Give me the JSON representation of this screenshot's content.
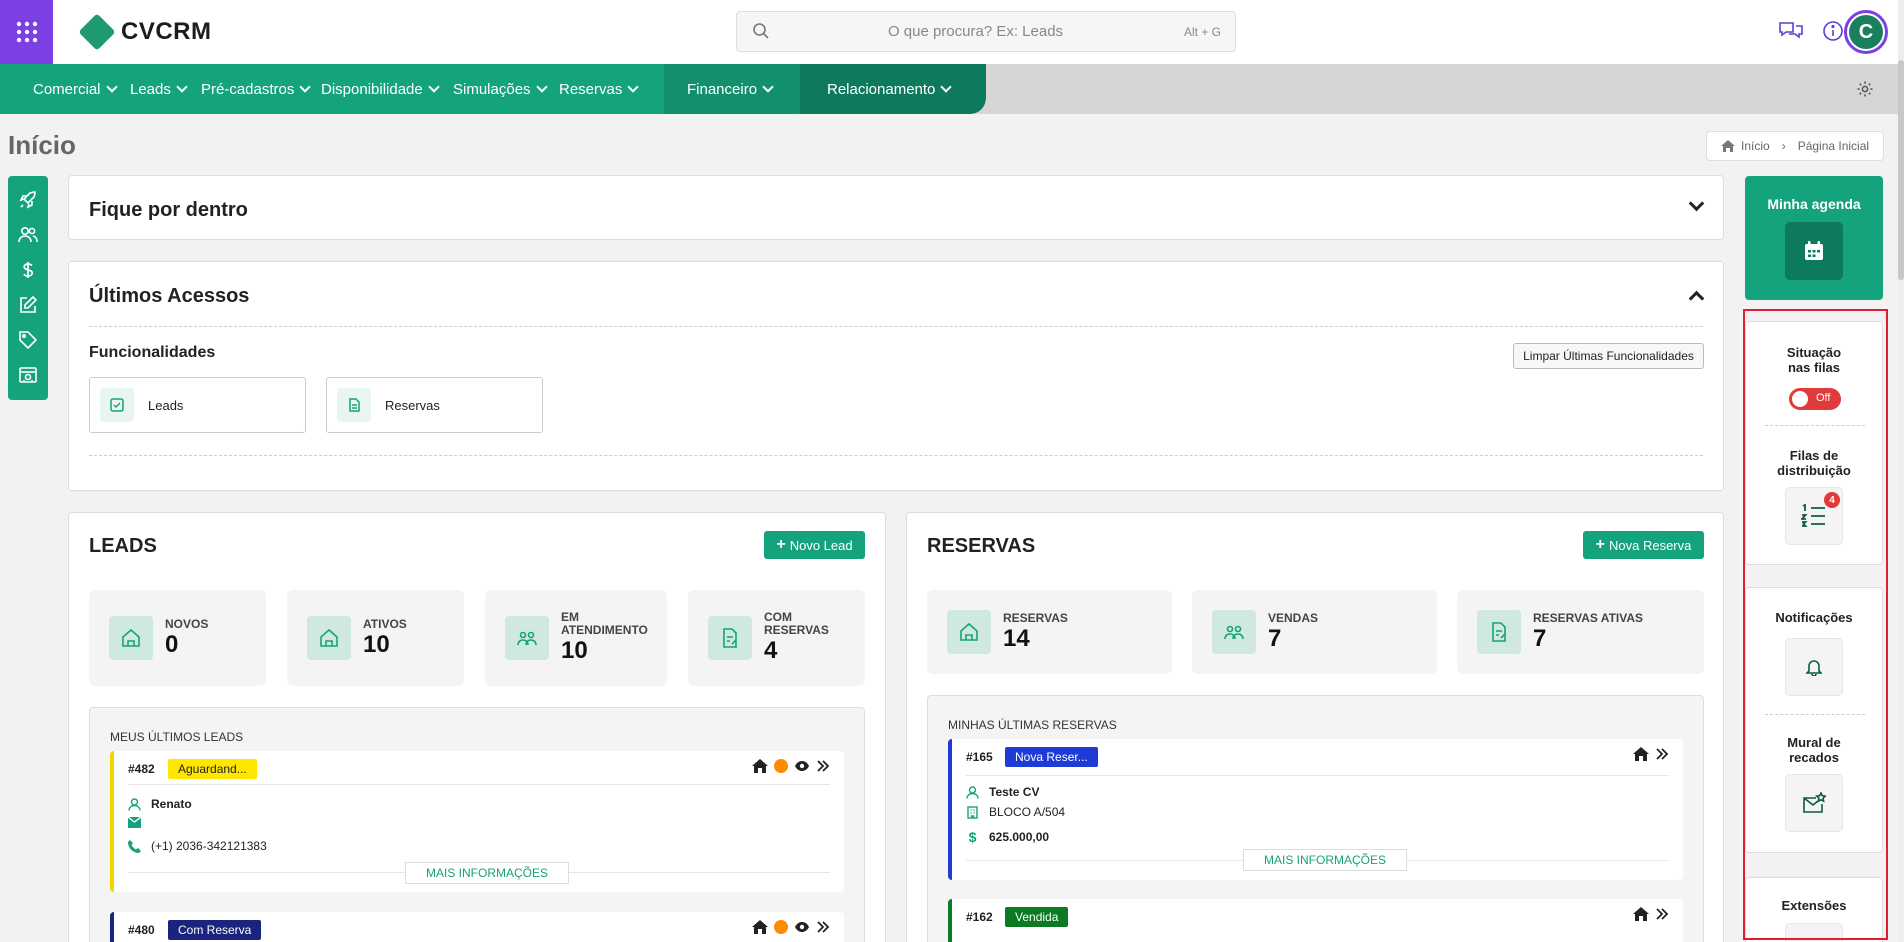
{
  "app": {
    "name": "CVCRM"
  },
  "search": {
    "placeholder": "O que procura? Ex: Leads",
    "shortcut": "Alt + G"
  },
  "user": {
    "initial": "C"
  },
  "nav": {
    "items": [
      "Comercial",
      "Leads",
      "Pré-cadastros",
      "Disponibilidade",
      "Simulações",
      "Reservas",
      "Financeiro",
      "Relacionamento"
    ]
  },
  "page": {
    "title": "Início"
  },
  "breadcrumb": {
    "home": "Início",
    "current": "Página Inicial"
  },
  "fique": {
    "title": "Fique por dentro"
  },
  "ultimos": {
    "title": "Últimos Acessos",
    "section": "Funcionalidades",
    "clear_label": "Limpar Últimas Funcionalidades",
    "items": [
      {
        "label": "Leads"
      },
      {
        "label": "Reservas"
      }
    ]
  },
  "leads": {
    "title": "LEADS",
    "new_label": "Novo Lead",
    "stats": [
      {
        "label": "NOVOS",
        "value": "0"
      },
      {
        "label": "ATIVOS",
        "value": "10"
      },
      {
        "label": "EM ATENDIMENTO",
        "value": "10"
      },
      {
        "label": "COM RESERVAS",
        "value": "4"
      }
    ],
    "list_title": "MEUS ÚLTIMOS LEADS",
    "items": [
      {
        "id": "#482",
        "status": "Aguardand...",
        "name": "Renato",
        "phone": "(+1) 2036-342121383",
        "more": "MAIS INFORMAÇÕES"
      },
      {
        "id": "#480",
        "status": "Com Reserva"
      }
    ]
  },
  "reservas": {
    "title": "RESERVAS",
    "new_label": "Nova Reserva",
    "stats": [
      {
        "label": "RESERVAS",
        "value": "14"
      },
      {
        "label": "VENDAS",
        "value": "7"
      },
      {
        "label": "RESERVAS ATIVAS",
        "value": "7"
      }
    ],
    "list_title": "MINHAS ÚLTIMAS RESERVAS",
    "items": [
      {
        "id": "#165",
        "status": "Nova Reser...",
        "client": "Teste CV",
        "unit": "BLOCO A/504",
        "value": "625.000,00",
        "more": "MAIS INFORMAÇÕES"
      },
      {
        "id": "#162",
        "status": "Vendida"
      }
    ]
  },
  "right": {
    "agenda": "Minha agenda",
    "filas_status": "Situação nas filas",
    "toggle": "Off",
    "filas_dist": "Filas de distribuição",
    "filas_badge": "4",
    "notificacoes": "Notificações",
    "mural": "Mural de recados",
    "extensoes": "Extensões"
  },
  "colors": {
    "accent": "#14a37c",
    "purple": "#7b3fe4",
    "highlight_border": "#e11d2f"
  }
}
